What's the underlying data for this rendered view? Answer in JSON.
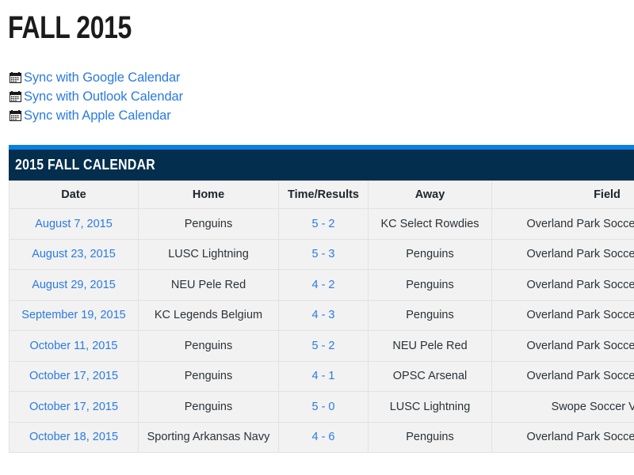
{
  "page": {
    "title": "FALL 2015"
  },
  "sync_links": [
    {
      "icon": "calendar-icon",
      "label": "Sync with Google Calendar"
    },
    {
      "icon": "calendar-icon",
      "label": "Sync with Outlook Calendar"
    },
    {
      "icon": "calendar-icon",
      "label": "Sync with Apple Calendar"
    }
  ],
  "calendar_panel": {
    "heading": "2015 FALL CALENDAR",
    "accent_color": "#0b7fe0",
    "header_color": "#032e4d",
    "link_color": "#2a7ae2",
    "row_background": "#f2f2f2",
    "columns": [
      "Date",
      "Home",
      "Time/Results",
      "Away",
      "Field"
    ],
    "rows": [
      {
        "date": "August 7, 2015",
        "home": "Penguins",
        "result": "5 - 2",
        "away": "KC Select Rowdies",
        "field": "Overland Park Soccer Complex"
      },
      {
        "date": "August 23, 2015",
        "home": "LUSC Lightning",
        "result": "5 - 3",
        "away": "Penguins",
        "field": "Overland Park Soccer Complex"
      },
      {
        "date": "August 29, 2015",
        "home": "NEU Pele Red",
        "result": "4 - 2",
        "away": "Penguins",
        "field": "Overland Park Soccer Complex"
      },
      {
        "date": "September 19, 2015",
        "home": "KC Legends Belgium",
        "result": "4 - 3",
        "away": "Penguins",
        "field": "Overland Park Soccer Complex"
      },
      {
        "date": "October 11, 2015",
        "home": "Penguins",
        "result": "5 - 2",
        "away": "NEU Pele Red",
        "field": "Overland Park Soccer Complex"
      },
      {
        "date": "October 17, 2015",
        "home": "Penguins",
        "result": "4 - 1",
        "away": "OPSC Arsenal",
        "field": "Overland Park Soccer Complex"
      },
      {
        "date": "October 17, 2015",
        "home": "Penguins",
        "result": "5 - 0",
        "away": "LUSC Lightning",
        "field": "Swope Soccer Village"
      },
      {
        "date": "October 18, 2015",
        "home": "Sporting Arkansas Navy",
        "result": "4 - 6",
        "away": "Penguins",
        "field": "Overland Park Soccer Complex"
      }
    ]
  }
}
